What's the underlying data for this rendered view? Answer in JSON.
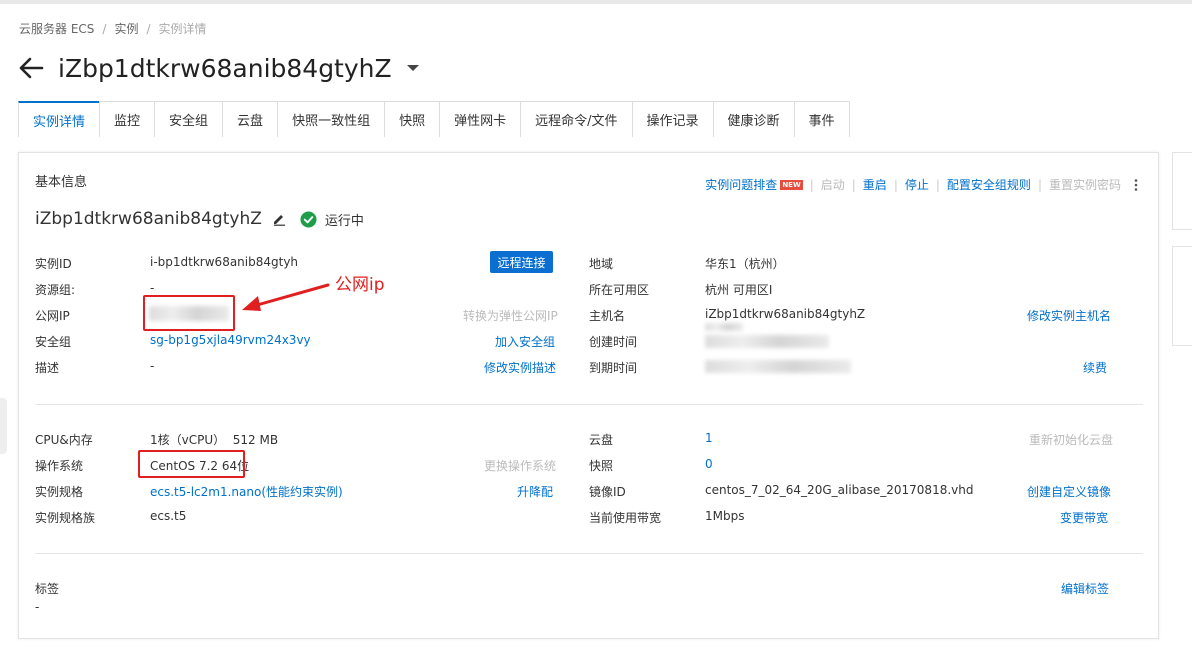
{
  "breadcrumb": {
    "root": "云服务器 ECS",
    "sep": "/",
    "mid": "实例",
    "current": "实例详情"
  },
  "title": "iZbp1dtkrw68anib84gtyhZ",
  "tabs": [
    "实例详情",
    "监控",
    "安全组",
    "云盘",
    "快照一致性组",
    "快照",
    "弹性网卡",
    "远程命令/文件",
    "操作记录",
    "健康诊断",
    "事件"
  ],
  "section": {
    "title": "基本信息"
  },
  "actions": {
    "troubleshoot": "实例问题排查",
    "new_badge": "NEW",
    "start": "启动",
    "restart": "重启",
    "stop": "停止",
    "config_sg": "配置安全组规则",
    "reset_pwd": "重置实例密码",
    "sep": "|"
  },
  "instance": {
    "name": "iZbp1dtkrw68anib84gtyhZ",
    "status": "运行中"
  },
  "basic": {
    "id_label": "实例ID",
    "id_value": "i-bp1dtkrw68anib84gtyh",
    "remote_btn": "远程连接",
    "rg_label": "资源组:",
    "rg_value": "-",
    "ip_label": "公网IP",
    "ip_action": "转换为弹性公网IP",
    "sg_label": "安全组",
    "sg_value": "sg-bp1g5xjla49rvm24x3vy",
    "sg_action": "加入安全组",
    "desc_label": "描述",
    "desc_value": "-",
    "desc_action": "修改实例描述",
    "region_label": "地域",
    "region_value": "华东1（杭州）",
    "zone_label": "所在可用区",
    "zone_value": "杭州 可用区I",
    "host_label": "主机名",
    "host_value": "iZbp1dtkrw68anib84gtyhZ",
    "host_action": "修改实例主机名",
    "created_label": "创建时间",
    "expire_label": "到期时间",
    "expire_action": "续费"
  },
  "config": {
    "cpu_label": "CPU&内存",
    "cpu_value": "1核（vCPU）  512 MB",
    "os_label": "操作系统",
    "os_value": "CentOS 7.2 64位",
    "os_action": "更换操作系统",
    "spec_label": "实例规格",
    "spec_value": "ecs.t5-lc2m1.nano(性能约束实例)",
    "spec_action": "升降配",
    "family_label": "实例规格族",
    "family_value": "ecs.t5",
    "disk_label": "云盘",
    "disk_value": "1",
    "disk_action": "重新初始化云盘",
    "snap_label": "快照",
    "snap_value": "0",
    "image_label": "镜像ID",
    "image_value": "centos_7_02_64_20G_alibase_20170818.vhd",
    "image_action": "创建自定义镜像",
    "bw_label": "当前使用带宽",
    "bw_value": "1Mbps",
    "bw_action": "变更带宽"
  },
  "tags": {
    "label": "标签",
    "value": "-",
    "action": "编辑标签"
  },
  "annotation": {
    "text": "公网ip",
    "color": "#e02020"
  },
  "colors": {
    "accent": "#0070cc",
    "button": "#0a6fd0",
    "running": "#1e9e4a",
    "annotation": "#e02020"
  },
  "icons": {
    "back": "arrow-left-icon",
    "caret": "caret-down-icon",
    "edit": "pencil-icon",
    "status": "check-circle-icon",
    "more": "more-vertical-icon"
  }
}
